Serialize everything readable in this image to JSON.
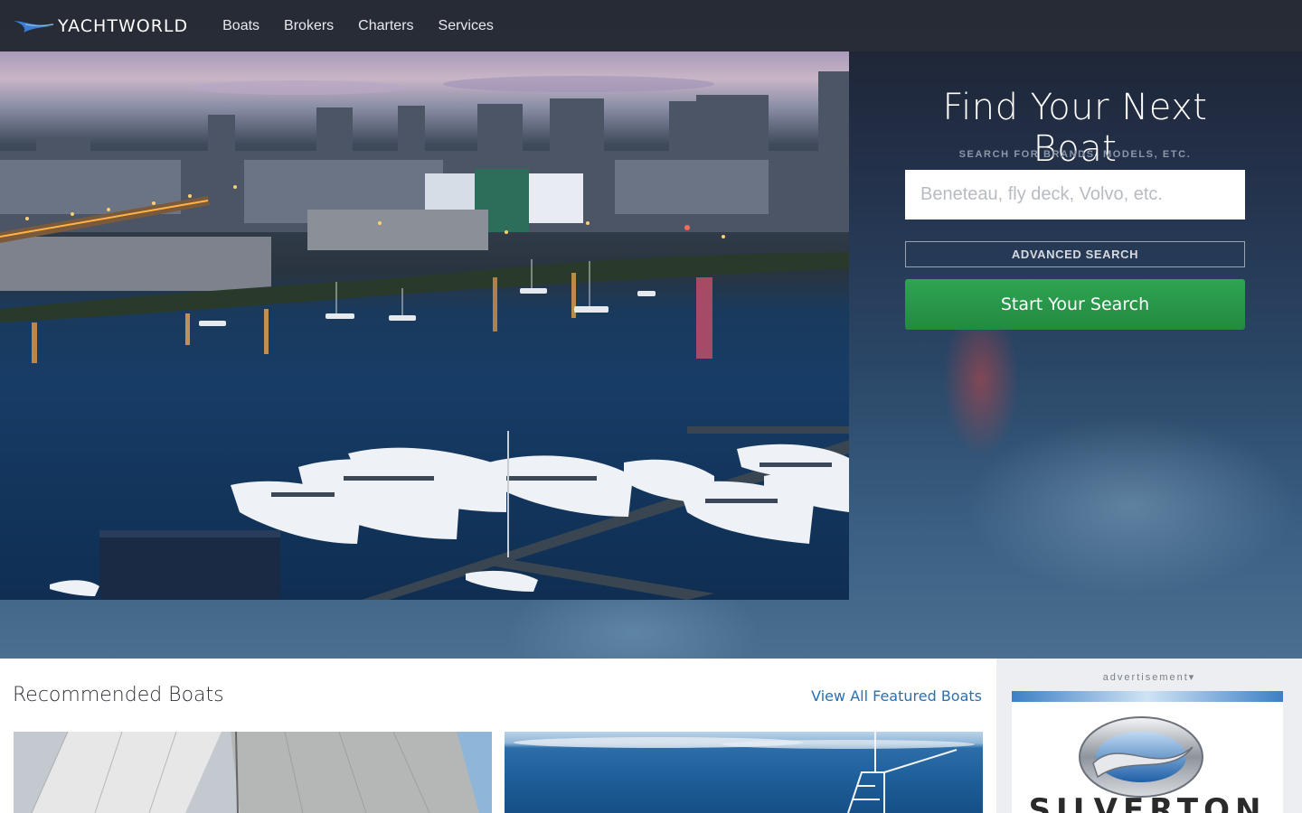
{
  "brand": {
    "name": "YACHTWORLD",
    "logo_icon": "swoosh-icon",
    "accent": "#3b7fd4"
  },
  "nav": {
    "items": [
      {
        "label": "Boats"
      },
      {
        "label": "Brokers"
      },
      {
        "label": "Charters"
      },
      {
        "label": "Services"
      }
    ]
  },
  "search": {
    "title": "Find Your Next Boat",
    "subtitle": "SEARCH FOR BRANDS, MODELS, ETC.",
    "placeholder": "Beneteau, fly deck, Volvo, etc.",
    "value": "",
    "advanced_label": "ADVANCED SEARCH",
    "submit_label": "Start Your Search",
    "submit_color": "#2a9a4a"
  },
  "recommended": {
    "title": "Recommended Boats",
    "view_all_label": "View All Featured Boats"
  },
  "ad": {
    "label": "advertisement▾",
    "brand_text": "SILVERTON"
  }
}
